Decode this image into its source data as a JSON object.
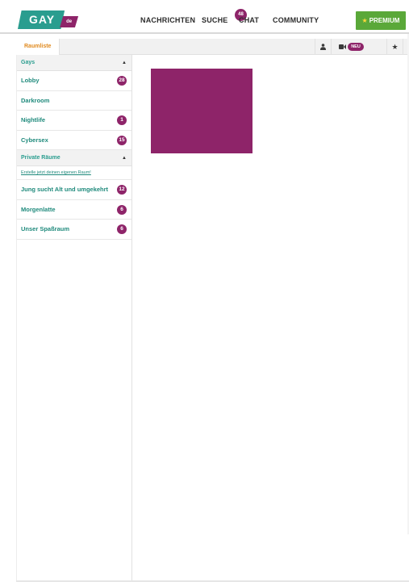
{
  "logo": {
    "main": "GAY",
    "tld": "de"
  },
  "nav": {
    "nachrichten": "NACHRICHTEN",
    "suche": "SUCHE",
    "chat": "CHAT",
    "chat_badge": "48",
    "community": "COMMUNITY",
    "premium": "PREMIUM"
  },
  "subbar": {
    "tab": "Raumliste",
    "neu_badge": "NEU"
  },
  "sidebar": {
    "gays": {
      "title": "Gays",
      "rooms": [
        {
          "label": "Lobby",
          "count": "28"
        },
        {
          "label": "Darkroom",
          "count": ""
        },
        {
          "label": "Nightlife",
          "count": "1"
        },
        {
          "label": "Cybersex",
          "count": "15"
        }
      ]
    },
    "private": {
      "title": "Private Räume",
      "create_link": "Erstelle jetzt deinen eigenen Raum!",
      "rooms": [
        {
          "label": "Jung sucht Alt und umgekehrt",
          "count": "12"
        },
        {
          "label": "Morgenlatte",
          "count": "6"
        },
        {
          "label": "Unser Spaßraum",
          "count": "6"
        }
      ]
    }
  },
  "colors": {
    "accent_teal": "#2a9d8f",
    "brand_purple": "#8e2469",
    "premium_green": "#5aa839",
    "tab_orange": "#e08a1e"
  },
  "icons": {
    "user": "user-icon",
    "camera": "video-camera-icon",
    "star": "star-icon",
    "gear": "gear-icon",
    "caret": "caret-up-icon"
  }
}
